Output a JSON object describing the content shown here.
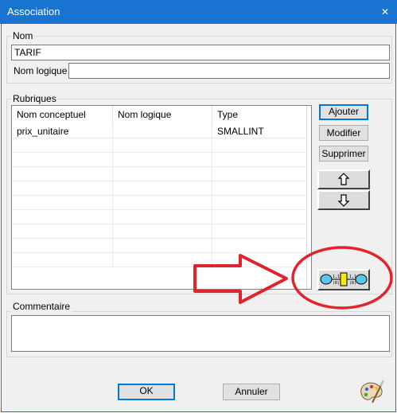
{
  "window": {
    "title": "Association",
    "close_glyph": "✕"
  },
  "nom_group": {
    "label": "Nom",
    "nom_value": "TARIF",
    "nom_logique_label": "Nom logique :",
    "nom_logique_value": ""
  },
  "rubriques": {
    "label": "Rubriques",
    "columns": [
      "Nom conceptuel",
      "Nom logique",
      "Type"
    ],
    "rows": [
      [
        "prix_unitaire",
        "",
        "SMALLINT"
      ]
    ],
    "empty_rows": 9
  },
  "side_buttons": {
    "ajouter": "Ajouter",
    "modifier": "Modifier",
    "supprimer": "Supprimer",
    "up_icon": "arrow-up-icon",
    "down_icon": "arrow-down-icon",
    "association_icon": "association-entity-icon"
  },
  "annotation": {
    "arrow_color": "#e0242a",
    "circle_color": "#e0242a"
  },
  "commentaire": {
    "label": "Commentaire",
    "value": ""
  },
  "footer": {
    "ok": "OK",
    "annuler": "Annuler",
    "palette_icon": "palette-icon"
  }
}
